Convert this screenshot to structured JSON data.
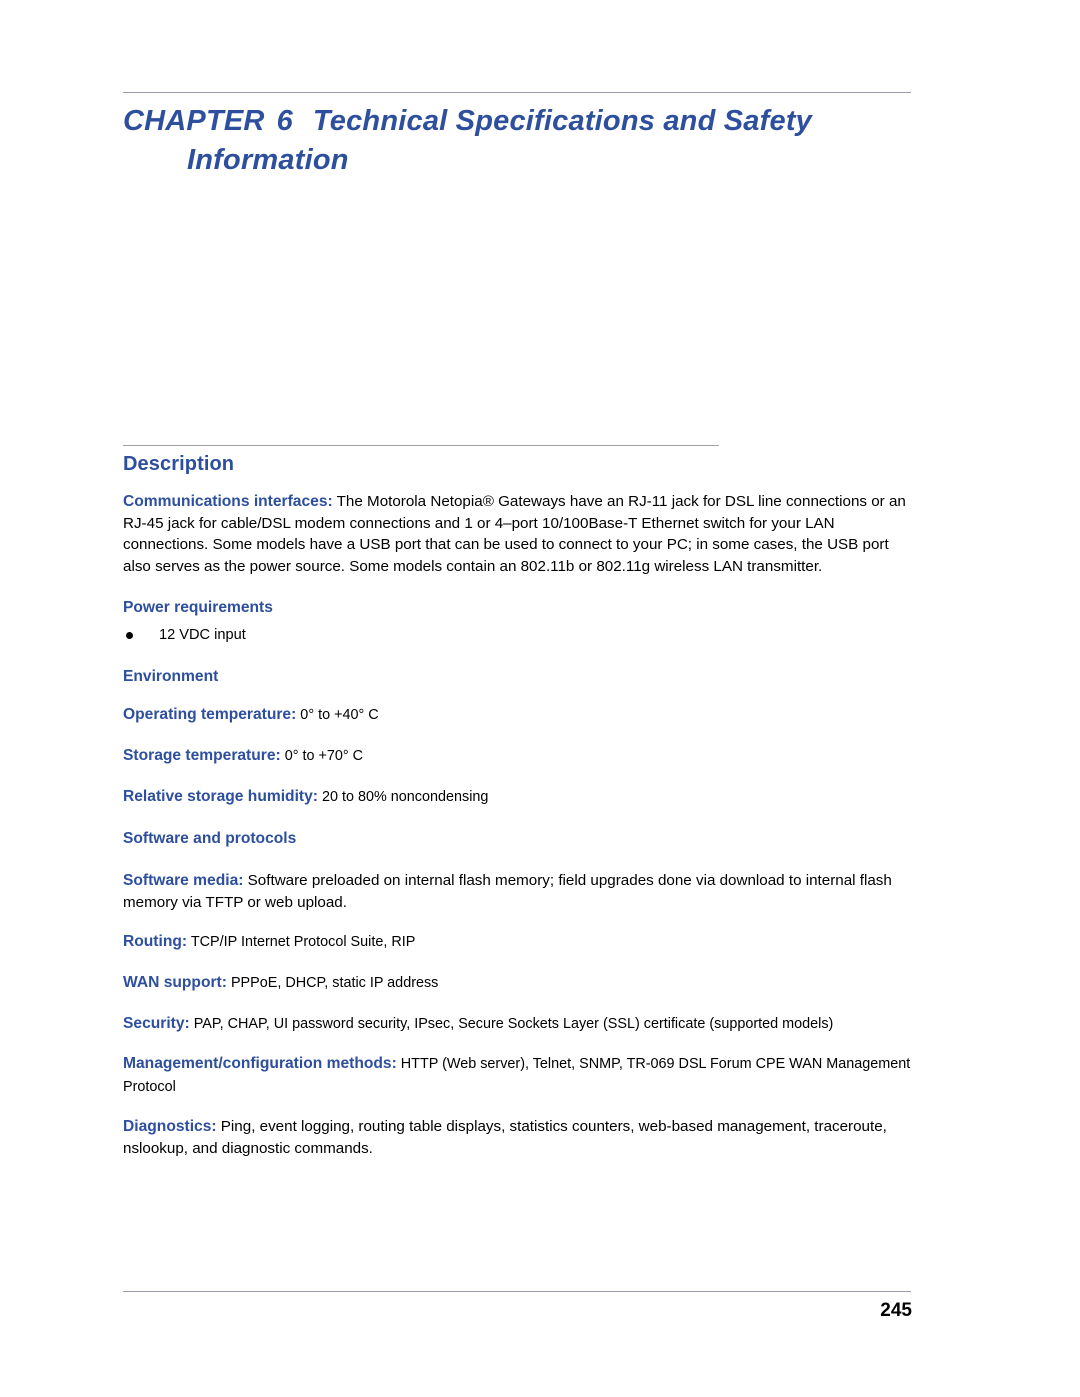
{
  "chapter": {
    "label": "CHAPTER",
    "number": "6",
    "title_line1": "Technical Specifications and Safety",
    "title_line2": "Information"
  },
  "section": {
    "heading": "Description"
  },
  "comm": {
    "lead": "Communications interfaces:",
    "text": " The Motorola Netopia® Gateways have an RJ-11 jack for DSL line connections or an RJ-45 jack for cable/DSL modem connections and 1 or 4–port 10/100Base-T Ethernet switch for your LAN connections. Some models have a USB port that can be used to connect to your PC; in some cases, the USB port also serves as the power source. Some models contain an 802.11b or 802.11g wireless LAN transmitter."
  },
  "power": {
    "heading": "Power requirements",
    "items": [
      "12 VDC input"
    ]
  },
  "environment": {
    "heading": "Environment",
    "operating_lead": "Operating temperature:",
    "operating_value": " 0° to +40° C",
    "storage_lead": "Storage temperature:",
    "storage_value": " 0° to +70° C",
    "humidity_lead": "Relative storage humidity:",
    "humidity_value": " 20 to 80% noncondensing"
  },
  "software": {
    "heading": "Software and protocols",
    "media_lead": "Software media:",
    "media_value": " Software preloaded on internal flash memory; field upgrades done via download to internal flash memory via TFTP or web upload.",
    "routing_lead": "Routing:",
    "routing_value": " TCP/IP Internet Protocol Suite, RIP",
    "wan_lead": "WAN support:",
    "wan_value": " PPPoE, DHCP, static IP address",
    "security_lead": "Security:",
    "security_value": " PAP, CHAP, UI password security, IPsec, Secure Sockets Layer (SSL) certificate (supported models)",
    "mgmt_lead": "Management/configuration methods:",
    "mgmt_value": " HTTP (Web server), Telnet, SNMP, TR-069 DSL Forum CPE WAN Management Protocol",
    "diag_lead": "Diagnostics:",
    "diag_value": " Ping, event logging, routing table displays, statistics counters, web-based management, traceroute, nslookup, and diagnostic commands."
  },
  "footer": {
    "page_number": "245"
  }
}
